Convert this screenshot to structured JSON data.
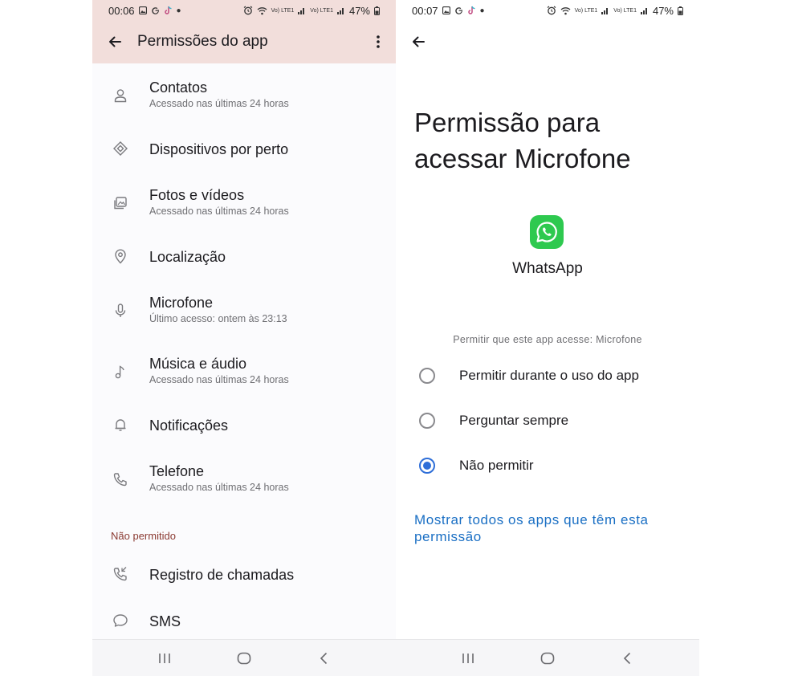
{
  "left": {
    "status": {
      "time": "00:06",
      "right_tiny": "Vo) LTE1",
      "battery": "47%"
    },
    "appbar": {
      "title": "Permissões do app"
    },
    "items": [
      {
        "title": "Contatos",
        "subtitle": "Acessado nas últimas 24 horas",
        "icon": "person-icon"
      },
      {
        "title": "Dispositivos por perto",
        "subtitle": "",
        "icon": "nearby-devices-icon"
      },
      {
        "title": "Fotos e vídeos",
        "subtitle": "Acessado nas últimas 24 horas",
        "icon": "photos-icon"
      },
      {
        "title": "Localização",
        "subtitle": "",
        "icon": "location-pin-icon"
      },
      {
        "title": "Microfone",
        "subtitle": "Último acesso: ontem às 23:13",
        "icon": "microphone-icon"
      },
      {
        "title": "Música e áudio",
        "subtitle": "Acessado nas últimas 24 horas",
        "icon": "music-note-icon"
      },
      {
        "title": "Notificações",
        "subtitle": "",
        "icon": "bell-icon"
      },
      {
        "title": "Telefone",
        "subtitle": "Acessado nas últimas 24 horas",
        "icon": "phone-icon"
      }
    ],
    "not_allowed_label": "Não permitido",
    "not_allowed_items": [
      {
        "title": "Registro de chamadas",
        "icon": "call-log-icon"
      },
      {
        "title": "SMS",
        "icon": "chat-bubble-icon"
      }
    ]
  },
  "right": {
    "status": {
      "time": "00:07",
      "right_tiny": "Vo) LTE1",
      "battery": "47%"
    },
    "title": "Permissão para acessar Microfone",
    "app_name": "WhatsApp",
    "allow_label": "Permitir que este app acesse: Microfone",
    "options": [
      {
        "label": "Permitir durante o uso do app",
        "selected": false
      },
      {
        "label": "Perguntar sempre",
        "selected": false
      },
      {
        "label": "Não permitir",
        "selected": true
      }
    ],
    "show_all_link": "Mostrar todos os apps que têm esta permissão"
  },
  "colors": {
    "appbar_bg": "#f2dedb",
    "accent_blue": "#2f6fd8",
    "link_blue": "#1a6fc4",
    "whatsapp_green": "#2ec94f",
    "not_allowed_red": "#8b3a32"
  }
}
